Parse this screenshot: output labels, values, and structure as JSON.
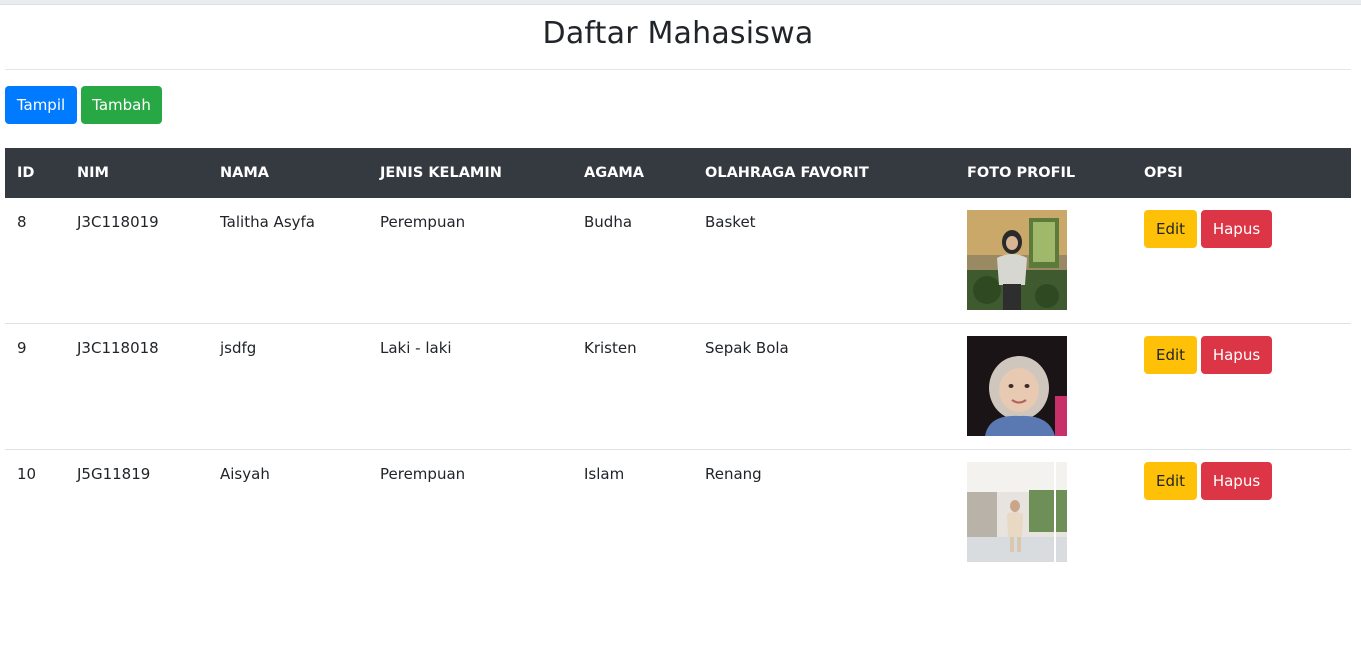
{
  "page": {
    "title": "Daftar Mahasiswa",
    "buttons": {
      "tampil": "Tampil",
      "tambah": "Tambah"
    }
  },
  "colors": {
    "primary": "#007bff",
    "success": "#28a745",
    "warning": "#ffc107",
    "danger": "#dc3545",
    "table_head": "#343a40"
  },
  "table": {
    "headers": [
      "ID",
      "NIM",
      "NAMA",
      "JENIS KELAMIN",
      "AGAMA",
      "OLAHRAGA FAVORIT",
      "FOTO PROFIL",
      "OPSI"
    ],
    "rows": [
      {
        "id": "8",
        "nim": "J3C118019",
        "nama": "Talitha Asyfa",
        "jenis_kelamin": "Perempuan",
        "agama": "Budha",
        "olahraga": "Basket",
        "foto": "profile-photo",
        "edit": "Edit",
        "hapus": "Hapus"
      },
      {
        "id": "9",
        "nim": "J3C118018",
        "nama": "jsdfg",
        "jenis_kelamin": "Laki - laki",
        "agama": "Kristen",
        "olahraga": "Sepak Bola",
        "foto": "profile-photo",
        "edit": "Edit",
        "hapus": "Hapus"
      },
      {
        "id": "10",
        "nim": "J5G11819",
        "nama": "Aisyah",
        "jenis_kelamin": "Perempuan",
        "agama": "Islam",
        "olahraga": "Renang",
        "foto": "profile-photo",
        "edit": "Edit",
        "hapus": "Hapus"
      }
    ]
  }
}
